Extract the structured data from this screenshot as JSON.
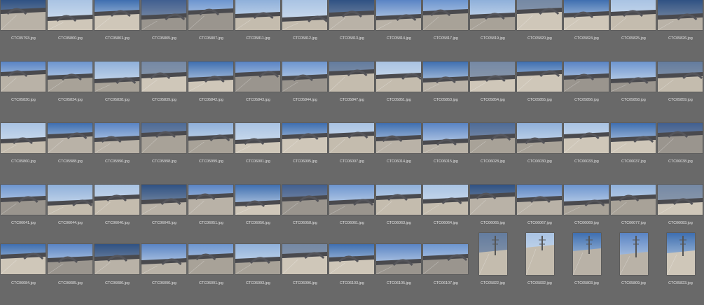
{
  "browser": {
    "rows": [
      [
        "CTC05793.jpg",
        "CTC05800.jpg",
        "CTC05801.jpg",
        "CTC05805.jpg",
        "CTC05807.jpg",
        "CTC05811.jpg",
        "CTC05812.jpg",
        "CTC05813.jpg",
        "CTC05814.jpg",
        "CTC05817.jpg",
        "CTC05819.jpg",
        "CTC05820.jpg",
        "CTC05824.jpg",
        "CTC05825.jpg",
        "CTC05826.jpg"
      ],
      [
        "CTC05830.jpg",
        "CTC05834.jpg",
        "CTC05838.jpg",
        "CTC05839.jpg",
        "CTC05842.jpg",
        "CTC05843.jpg",
        "CTC05844.jpg",
        "CTC05847.jpg",
        "CTC05851.jpg",
        "CTC05853.jpg",
        "CTC05854.jpg",
        "CTC05855.jpg",
        "CTC05856.jpg",
        "CTC05858.jpg",
        "CTC05859.jpg"
      ],
      [
        "CTC05860.jpg",
        "CTC05988.jpg",
        "CTC05996.jpg",
        "CTC05998.jpg",
        "CTC05999.jpg",
        "CTC06001.jpg",
        "CTC06005.jpg",
        "CTC06007.jpg",
        "CTC06014.jpg",
        "CTC06015.jpg",
        "CTC06028.jpg",
        "CTC06030.jpg",
        "CTC06033.jpg",
        "CTC06037.jpg",
        "CTC06038.jpg"
      ],
      [
        "CTC06041.jpg",
        "CTC06044.jpg",
        "CTC06046.jpg",
        "CTC06049.jpg",
        "CTC06051.jpg",
        "CTC06056.jpg",
        "CTC06058.jpg",
        "CTC06061.jpg",
        "CTC06063.jpg",
        "CTC06064.jpg",
        "CTC06065.jpg",
        "CTC06067.jpg",
        "CTC06069.jpg",
        "CTC06077.jpg",
        "CTC06083.jpg"
      ],
      [
        "CTC06084.jpg",
        "CTC06085.jpg",
        "CTC06086.jpg",
        "CTC06090.jpg",
        "CTC06091.jpg",
        "CTC06093.jpg",
        "CTC06096.jpg",
        "CTC06103.jpg",
        "CTC06105.jpg",
        "CTC06107.jpg",
        "CTC05822.jpg",
        "CTC05832.jpg",
        "CTC05803.jpg",
        "CTC05809.jpg",
        "CTC05823.jpg"
      ]
    ]
  }
}
